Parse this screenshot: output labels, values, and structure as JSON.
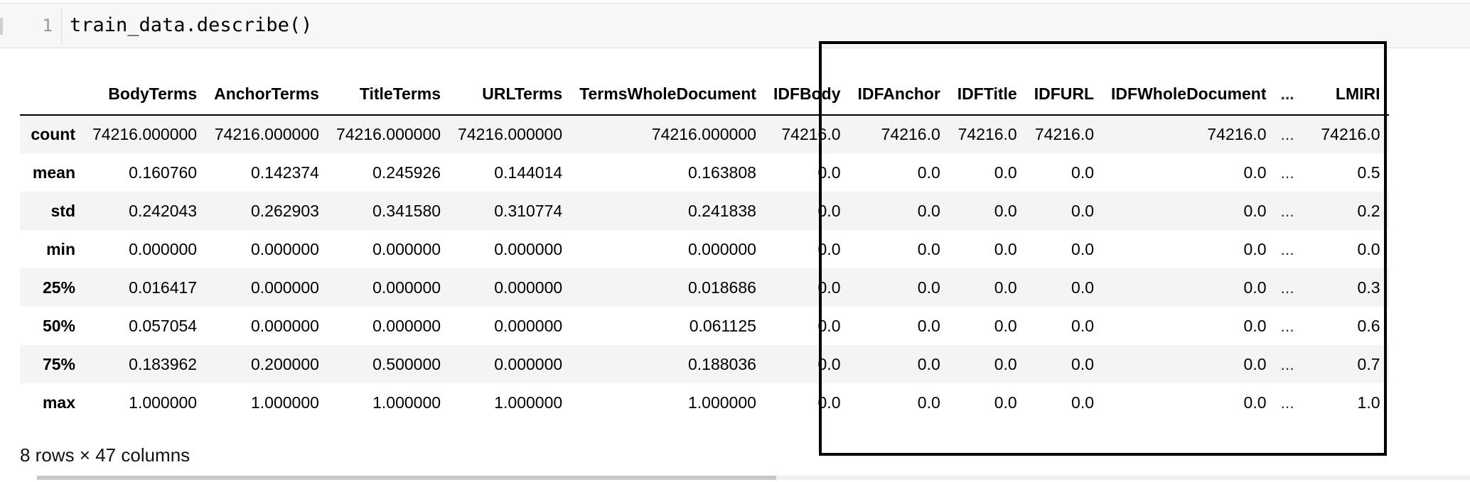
{
  "code_cell": {
    "line_number": "1",
    "code": "train_data.describe()"
  },
  "table": {
    "columns": [
      "",
      "BodyTerms",
      "AnchorTerms",
      "TitleTerms",
      "URLTerms",
      "TermsWholeDocument",
      "IDFBody",
      "IDFAnchor",
      "IDFTitle",
      "IDFURL",
      "IDFWholeDocument",
      "...",
      "LMIRI"
    ],
    "rows": [
      {
        "label": "count",
        "values": [
          "74216.000000",
          "74216.000000",
          "74216.000000",
          "74216.000000",
          "74216.000000",
          "74216.0",
          "74216.0",
          "74216.0",
          "74216.0",
          "74216.0",
          "...",
          "74216.0"
        ]
      },
      {
        "label": "mean",
        "values": [
          "0.160760",
          "0.142374",
          "0.245926",
          "0.144014",
          "0.163808",
          "0.0",
          "0.0",
          "0.0",
          "0.0",
          "0.0",
          "...",
          "0.5"
        ]
      },
      {
        "label": "std",
        "values": [
          "0.242043",
          "0.262903",
          "0.341580",
          "0.310774",
          "0.241838",
          "0.0",
          "0.0",
          "0.0",
          "0.0",
          "0.0",
          "...",
          "0.2"
        ]
      },
      {
        "label": "min",
        "values": [
          "0.000000",
          "0.000000",
          "0.000000",
          "0.000000",
          "0.000000",
          "0.0",
          "0.0",
          "0.0",
          "0.0",
          "0.0",
          "...",
          "0.0"
        ]
      },
      {
        "label": "25%",
        "values": [
          "0.016417",
          "0.000000",
          "0.000000",
          "0.000000",
          "0.018686",
          "0.0",
          "0.0",
          "0.0",
          "0.0",
          "0.0",
          "...",
          "0.3"
        ]
      },
      {
        "label": "50%",
        "values": [
          "0.057054",
          "0.000000",
          "0.000000",
          "0.000000",
          "0.061125",
          "0.0",
          "0.0",
          "0.0",
          "0.0",
          "0.0",
          "...",
          "0.6"
        ]
      },
      {
        "label": "75%",
        "values": [
          "0.183962",
          "0.200000",
          "0.500000",
          "0.000000",
          "0.188036",
          "0.0",
          "0.0",
          "0.0",
          "0.0",
          "0.0",
          "...",
          "0.7"
        ]
      },
      {
        "label": "max",
        "values": [
          "1.000000",
          "1.000000",
          "1.000000",
          "1.000000",
          "1.000000",
          "0.0",
          "0.0",
          "0.0",
          "0.0",
          "0.0",
          "...",
          "1.0"
        ]
      }
    ]
  },
  "shape_text": "8 rows × 47 columns"
}
